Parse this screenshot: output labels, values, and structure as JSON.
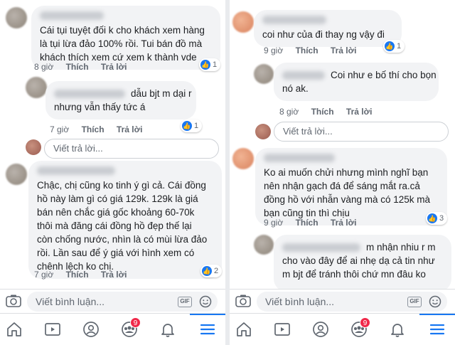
{
  "left": {
    "comments": [
      {
        "lines": [
          "Cái tụi tuyệt đối k cho khách xem hàng",
          "là tụi lừa đảo 100% rồi. Tui bán đồ mà",
          "khách thích xem cứ xem k thành vde"
        ],
        "time": "8 giờ",
        "like": "Thích",
        "reply": "Trả lời",
        "reactions": "1"
      },
      {
        "lines": [
          "dẫu bjt m dại r",
          "nhưng vẫn thấy tức á"
        ],
        "time": "7 giờ",
        "like": "Thích",
        "reply": "Trả lời",
        "reactions": "1"
      },
      {
        "lines": [
          "Chậc, chị cũng ko tinh ý gì cả. Cái đồng",
          "hồ này làm gì có giá 129k. 129k là giá",
          "bán nên chắc giá gốc khoảng 60-70k",
          "thôi mà đăng cái đồng hồ đẹp thế lại",
          "còn chống nước, nhìn là có mùi lừa đảo",
          "rồi. Lần sau để ý giá với hình xem có",
          "chênh lệch ko chị."
        ],
        "time": "7 giờ",
        "like": "Thích",
        "reply": "Trả lời",
        "reactions": "2"
      }
    ],
    "reply_placeholder": "Viết trả lời...",
    "comment_placeholder": "Viết bình luận..."
  },
  "right": {
    "comments": [
      {
        "lines": [
          "coi như của đi thay ng vậy đi"
        ],
        "time": "9 giờ",
        "like": "Thích",
        "reply": "Trả lời",
        "reactions": "1"
      },
      {
        "lines": [
          "Coi như e bố thí cho bọn",
          "nó ak."
        ],
        "time": "8 giờ",
        "like": "Thích",
        "reply": "Trả lời"
      },
      {
        "lines": [
          "Ko ai muốn chửi nhưng mình nghĩ bạn",
          "nên nhận gạch đá để sáng mắt ra.cả",
          "đồng hồ với nhẫn vàng mà có 125k mà",
          "bạn cũng tin thì chịu"
        ],
        "time": "9 giờ",
        "like": "Thích",
        "reply": "Trả lời",
        "reactions": "3"
      },
      {
        "lines": [
          "m nhận nhiu r m",
          "cho vào đây để ai nhẹ dạ cả tin như",
          "m bjt để tránh thôi chứ mn đâu ko"
        ]
      }
    ],
    "reply_placeholder": "Viết trả lời...",
    "comment_placeholder": "Viết bình luận..."
  },
  "nav": {
    "notification_count": "9"
  },
  "colors": {
    "accent": "#1877f2",
    "badge": "#f02849",
    "bubble": "#f2f3f5"
  }
}
